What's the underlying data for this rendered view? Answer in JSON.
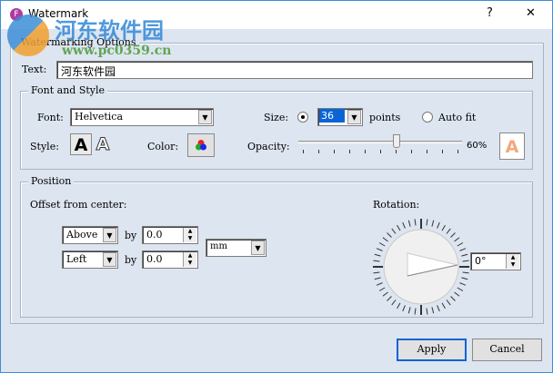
{
  "window": {
    "title": "Watermark",
    "help": "?",
    "close": "✕"
  },
  "watermark_logo": {
    "cn": "河东软件园",
    "url": "www.pc0359.cn"
  },
  "options": {
    "group_label": "Watermarking Options",
    "text_label": "Text:",
    "text_value": "河东软件园"
  },
  "font_style": {
    "group_label": "Font and Style",
    "font_label": "Font:",
    "font_value": "Helvetica",
    "size_label": "Size:",
    "size_value": "36",
    "points_label": "points",
    "auto_fit_label": "Auto fit",
    "style_label": "Style:",
    "style_bold": "A",
    "style_outline": "A",
    "color_label": "Color:",
    "opacity_label": "Opacity:",
    "opacity_value": "60%",
    "opacity_fraction": 0.6,
    "preview": "A",
    "preview_color": "#f5a77a",
    "size_mode": "points"
  },
  "position": {
    "group_label": "Position",
    "offset_label": "Offset from center:",
    "vertical": "Above",
    "horizontal": "Left",
    "by_label": "by",
    "v_offset": "0.0",
    "h_offset": "0.0",
    "unit": "mm",
    "rotation_label": "Rotation:",
    "rotation_value": "0°",
    "rotation_degrees": 0
  },
  "buttons": {
    "apply": "Apply",
    "cancel": "Cancel"
  }
}
